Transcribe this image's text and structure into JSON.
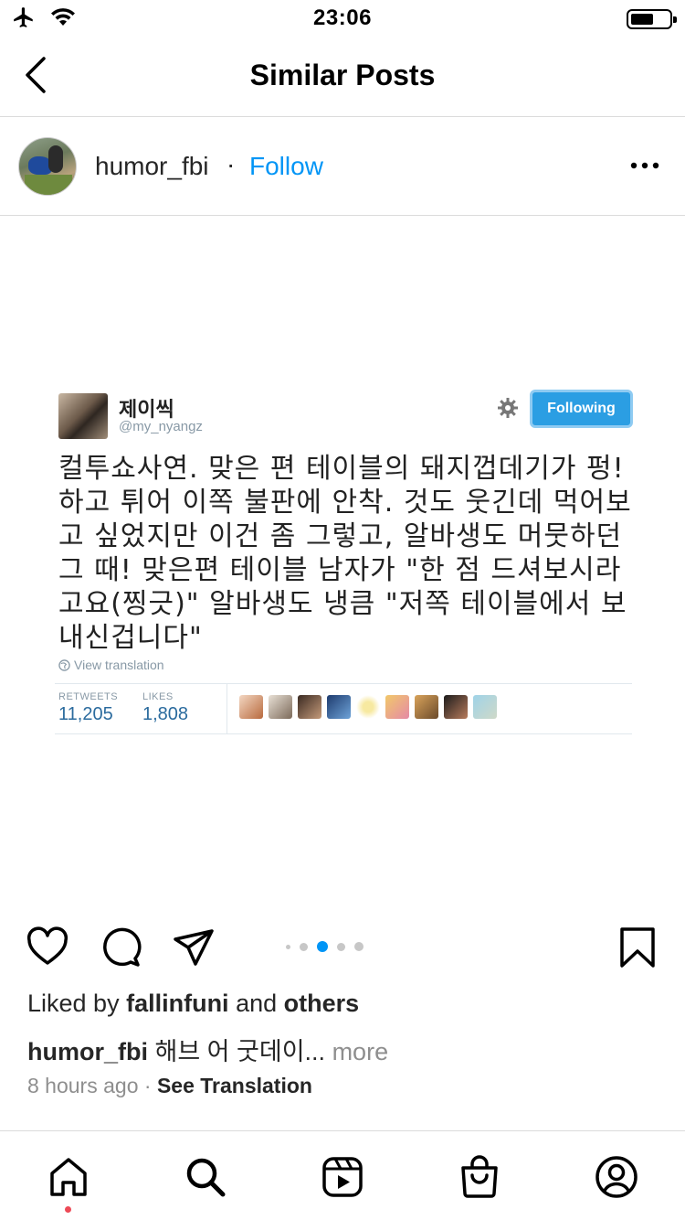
{
  "status_bar": {
    "time": "23:06",
    "icons": [
      "airplane-icon",
      "wifi-icon",
      "battery-icon"
    ]
  },
  "header": {
    "title": "Similar Posts",
    "back_icon": "chevron-left-icon"
  },
  "post": {
    "username": "humor_fbi",
    "separator": "·",
    "follow_label": "Follow",
    "more_icon": "ellipsis-icon",
    "tweet": {
      "name": "제이씩",
      "handle": "@my_nyangz",
      "following_label": "Following",
      "body": "컬투쇼사연. 맞은 편 테이블의 돼지껍데기가 펑! 하고 튀어 이쪽 불판에 안착. 것도 웃긴데 먹어보고 싶었지만 이건 좀 그렇고, 알바생도 머뭇하던 그 때! 맞은편 테이블 남자가 \"한 점 드셔보시라고요(찡긋)\" 알바생도 냉큼 \"저쪽 테이블에서 보내신겁니다\"",
      "view_translation": "View translation",
      "retweets_label": "RETWEETS",
      "retweets_value": "11,205",
      "likes_label": "LIKES",
      "likes_value": "1,808"
    },
    "carousel": {
      "count": 5,
      "active_index": 2
    },
    "liked_by": {
      "prefix": "Liked by ",
      "user": "fallinfuni",
      "middle": " and ",
      "others": "others"
    },
    "caption": {
      "user": "humor_fbi",
      "text": " 해브 어 굿데이...",
      "more": " more"
    },
    "time_ago": "8 hours ago",
    "meta_sep": " · ",
    "see_translation": "See Translation"
  },
  "colors": {
    "link_blue": "#0095f6",
    "tweet_blue": "#2b9ee3",
    "notification_dot": "#ed4956"
  },
  "tab_bar": {
    "items": [
      "home-icon",
      "search-icon",
      "reels-icon",
      "shop-icon",
      "profile-icon"
    ],
    "active": "home-icon"
  }
}
